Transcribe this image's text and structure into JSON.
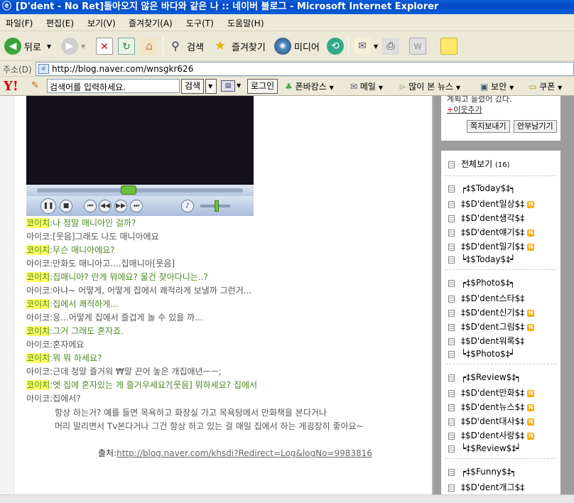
{
  "window": {
    "title": "[D'dent - No Ret]돌아오지 않은 바다와 같은 나 :: 네이버 블로그 - Microsoft Internet Explorer"
  },
  "menu": [
    "파일(F)",
    "편집(E)",
    "보기(V)",
    "즐겨찾기(A)",
    "도구(T)",
    "도움말(H)"
  ],
  "toolbar": {
    "back": "뒤로",
    "search": "검색",
    "favorites": "즐겨찾기",
    "media": "미디어"
  },
  "address": {
    "label": "주소(D)",
    "url": "http://blog.naver.com/wnsgkr626"
  },
  "yahoo": {
    "search_placeholder": "검색어를 입력하세요.",
    "search_button": "검색",
    "login": "로그인",
    "items": [
      "폰바캉스",
      "메일",
      "많이 본 뉴스",
      "보안",
      "쿠폰"
    ]
  },
  "dialogue": [
    {
      "speaker": "코이치",
      "text": ":나 정말 매니아인 걸까?",
      "hl": true
    },
    {
      "speaker": "아이코",
      "text": ":[웃음]그래도 나도 매니아에요",
      "hl": false
    },
    {
      "speaker": "코이치",
      "text": ":무슨 매니아에요?",
      "hl": true
    },
    {
      "speaker": "아이코",
      "text": ":만화도 매니아고....집매니아[웃음]",
      "hl": false
    },
    {
      "speaker": "코이치",
      "text": ":집매니아? 란게 뭐에요? 물건 찾아다니는..?",
      "hl": true
    },
    {
      "speaker": "아이코",
      "text": ":아냐~ 어떻게, 어떻게 집에서 쾌적라게 보낼까 그런거...",
      "hl": false
    },
    {
      "speaker": "코이치",
      "text": ":집에서 쾌적하게...",
      "hl": true
    },
    {
      "speaker": "아이코",
      "text": ":응...어떻게 집에서 즐겁게 놀 수 있을 까...",
      "hl": false
    },
    {
      "speaker": "코이치",
      "text": ":그거 그래도 혼자죠.",
      "hl": true
    },
    {
      "speaker": "아이코",
      "text": ":혼자에요",
      "hl": false
    },
    {
      "speaker": "코이치",
      "text": ":뭐 뭐 하세요?",
      "hl": true
    },
    {
      "speaker": "아이코",
      "text": ":근데 정말 즐거워 ₩말 끈어 놓은 개집애년ㅡㅡ;",
      "hl": false
    },
    {
      "speaker": "코이치",
      "text": ":엣 집에 혼자있는 게 즐거우세요?[웃음] 뭐하세요? 집에서",
      "hl": true
    },
    {
      "speaker": "아이코",
      "text": ":집에서?",
      "hl": false
    }
  ],
  "continuation": [
    "항상 하는거? 예를 들면 목욕하고 화장실 가고 목욕탕에서 만화책을 본다거나",
    "머리 말리면서 Tv본다거나 그건 항상 하고 있는 걸 매일 집에서 하는 게굉장히 좋아요~"
  ],
  "source": {
    "label": "출처:",
    "link": "http://blog.naver.com/khsdi?Redirect=Log&logNo=9983816"
  },
  "sidebar": {
    "top_text": "계획고 들렸어 갔다.",
    "add_neighbor": "이웃추가",
    "buttons": [
      "쪽지보내기",
      "안부남기기"
    ],
    "all_view": "전체보기",
    "all_count": "(16)",
    "groups": [
      [
        {
          "label": "┍‡$Today$‡┑",
          "new": false
        },
        {
          "label": "‡$D'dent일상$‡",
          "new": true
        },
        {
          "label": "‡$D'dent생각$‡",
          "new": false
        },
        {
          "label": "‡$D'dent얘기$‡",
          "new": true
        },
        {
          "label": "‡$D'dent일기$‡",
          "new": true
        },
        {
          "label": "┕‡$Today$‡┙",
          "new": false
        }
      ],
      [
        {
          "label": "┍‡$Photo$‡┑",
          "new": false
        },
        {
          "label": "‡$D'dent스타$‡",
          "new": false
        },
        {
          "label": "‡$D'dent신기$‡",
          "new": true
        },
        {
          "label": "‡$D'dent그림$‡",
          "new": true
        },
        {
          "label": "‡$D'dent워록$‡",
          "new": false
        },
        {
          "label": "┕‡$Photo$‡┙",
          "new": false
        }
      ],
      [
        {
          "label": "┍‡$Review$‡┑",
          "new": false
        },
        {
          "label": "‡$D'dent만화$‡",
          "new": true
        },
        {
          "label": "‡$D'dent뉴스$‡",
          "new": true
        },
        {
          "label": "‡$D'dent대사$‡",
          "new": true
        },
        {
          "label": "‡$D'dent사랑$‡",
          "new": true
        },
        {
          "label": "┕‡$Review$‡┙",
          "new": false
        }
      ],
      [
        {
          "label": "┍‡$Funny$‡┑",
          "new": false
        },
        {
          "label": "‡$D'dent개그$‡",
          "new": false
        }
      ]
    ],
    "new_badge": "N"
  },
  "colors": {
    "titlebar": "#0a5fd8",
    "highlight": "#ffff66",
    "speaker_hl_text": "#4a8a20",
    "sidebar_bg": "#9d9d9d"
  }
}
